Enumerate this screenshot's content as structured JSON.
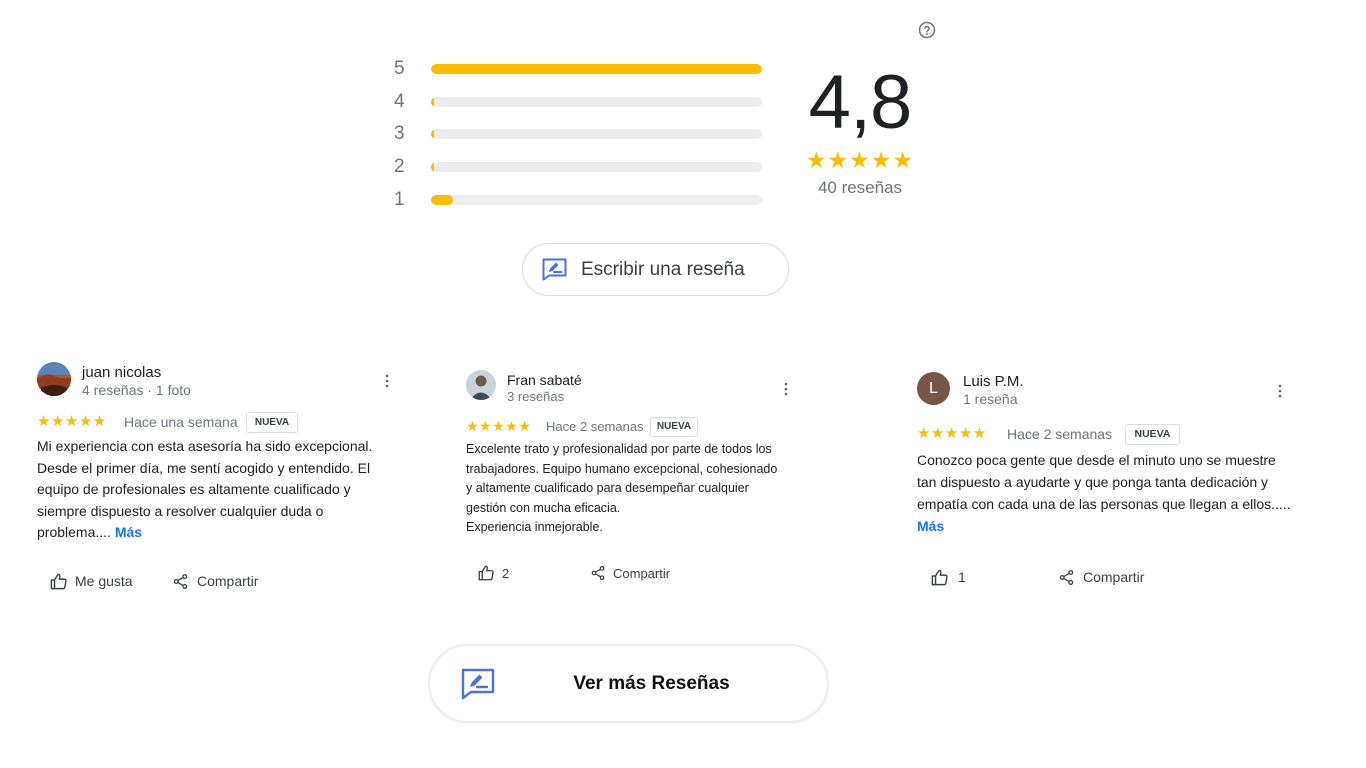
{
  "colors": {
    "star": "#fbbc04",
    "bar_fill": "#fbbc04",
    "bar_track": "#ececec",
    "link": "#1a73e8",
    "icon_blue": "#4a72d9"
  },
  "icons": {
    "help": "help-circle-icon",
    "write_review": "rate-review-icon",
    "menu": "more-vert-icon",
    "like": "thumb-up-outline-icon",
    "share": "share-icon"
  },
  "summary": {
    "distribution": [
      {
        "stars": "5",
        "fraction": 1.0
      },
      {
        "stars": "4",
        "fraction": 0.01
      },
      {
        "stars": "3",
        "fraction": 0.01
      },
      {
        "stars": "2",
        "fraction": 0.01
      },
      {
        "stars": "1",
        "fraction": 0.065
      }
    ],
    "average": "4,8",
    "stars": "★★★★★",
    "count_label": "40 reseñas"
  },
  "write_review_label": "Escribir una reseña",
  "reviews": [
    {
      "name": "juan nicolas",
      "meta": "4 reseñas · 1 foto",
      "stars": "★★★★★",
      "date": "Hace una semana",
      "badge": "NUEVA",
      "text": "Mi experiencia con esta asesoría ha sido excepcional. Desde el primer día, me sentí acogido y entendido. El equipo de profesionales es altamente cualificado y siempre dispuesto a resolver cualquier duda o problema....",
      "more": "Más",
      "like_label": "Me gusta",
      "share_label": "Compartir"
    },
    {
      "name": "Fran sabaté",
      "meta": "3 reseñas",
      "stars": "★★★★★",
      "date": "Hace 2 semanas",
      "badge": "NUEVA",
      "text_lines": [
        "Excelente trato y profesionalidad por parte de todos los",
        "trabajadores. Equipo humano excepcional, cohesionado",
        "y altamente cualificado para desempeñar cualquier",
        "gestión con mucha eficacia.",
        "Experiencia inmejorable."
      ],
      "like_count": "2",
      "share_label": "Compartir"
    },
    {
      "name": "Luis P.M.",
      "meta": "1 reseña",
      "avatar_letter": "L",
      "avatar_color": "#795548",
      "stars": "★★★★★",
      "date": "Hace 2 semanas",
      "badge": "NUEVA",
      "text": "Conozco poca gente que desde el minuto uno se muestre tan dispuesto a ayudarte y que ponga tanta dedicación y empatía con cada una de las personas que llegan a ellos.....",
      "more": "Más",
      "like_count": "1",
      "share_label": "Compartir"
    }
  ],
  "more_reviews_label": "Ver más Reseñas"
}
